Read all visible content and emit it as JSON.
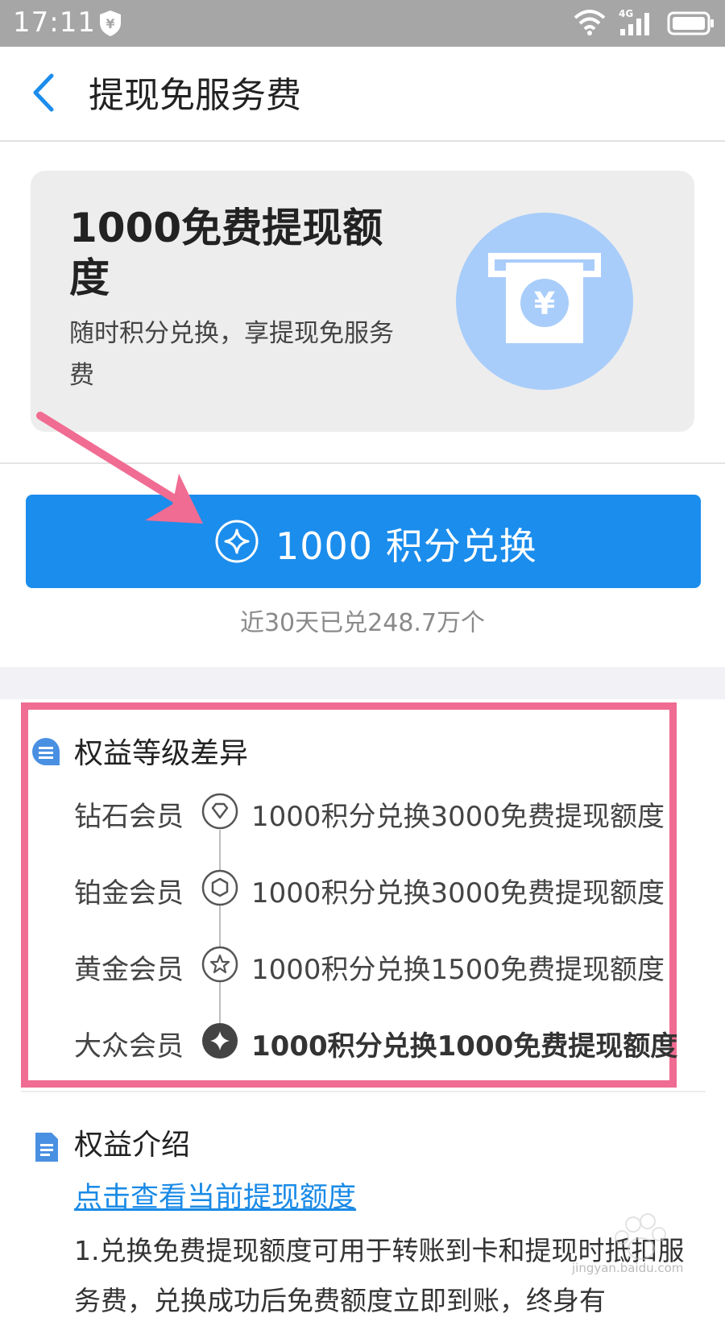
{
  "status_bar": {
    "time": "17:11",
    "network": "4G"
  },
  "header": {
    "title": "提现免服务费"
  },
  "card": {
    "title": "1000免费提现额度",
    "description": "随时积分兑换，享提现免服务费"
  },
  "exchange_button": {
    "label": "1000 积分兑换"
  },
  "exchange_stat": "近30天已兑248.7万个",
  "levels_section": {
    "title": "权益等级差异",
    "levels": [
      {
        "name": "钻石会员",
        "desc": "1000积分兑换3000免费提现额度",
        "icon": "diamond-icon"
      },
      {
        "name": "铂金会员",
        "desc": "1000积分兑换3000免费提现额度",
        "icon": "hexagon-icon"
      },
      {
        "name": "黄金会员",
        "desc": "1000积分兑换1500免费提现额度",
        "icon": "star-icon"
      },
      {
        "name": "大众会员",
        "desc": "1000积分兑换1000免费提现额度",
        "icon": "sparkle-icon"
      }
    ]
  },
  "intro_section": {
    "title": "权益介绍",
    "link": "点击查看当前提现额度",
    "body": "1.兑换免费提现额度可用于转账到卡和提现时抵扣服务费，兑换成功后免费额度立即到账，终身有"
  },
  "watermark": "jingyan.baidu.com",
  "colors": {
    "accent": "#1b8ded",
    "highlight_box": "#f06c92",
    "arrow": "#f06c92",
    "card_bg": "#ededed"
  }
}
